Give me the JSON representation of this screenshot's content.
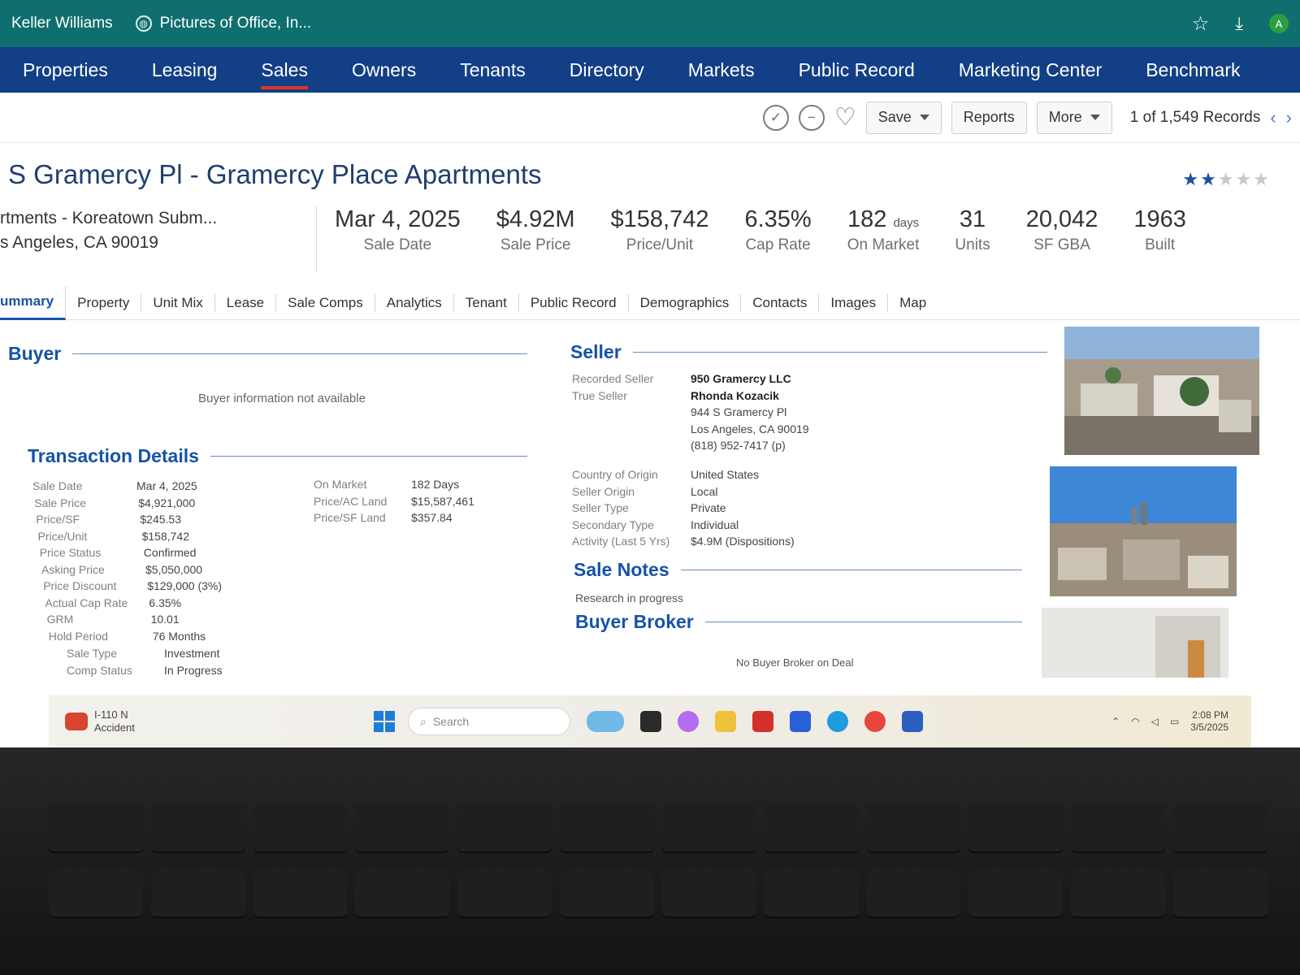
{
  "browser": {
    "bookmarks": [
      "Keller Williams",
      "Pictures of Office, In..."
    ],
    "avatar_initial": "A"
  },
  "nav": {
    "items": [
      "Properties",
      "Leasing",
      "Sales",
      "Owners",
      "Tenants",
      "Directory",
      "Markets",
      "Public Record",
      "Marketing Center",
      "Benchmark"
    ],
    "active": "Sales"
  },
  "toolbar": {
    "save_label": "Save",
    "reports_label": "Reports",
    "more_label": "More",
    "records_text": "1 of 1,549 Records"
  },
  "property": {
    "title": "S Gramercy Pl - Gramercy Place Apartments",
    "rating_stars": 2,
    "rating_max": 5,
    "address_line1": "rtments - Koreatown Subm...",
    "address_line2": "s Angeles, CA 90019"
  },
  "facts": [
    {
      "value": "Mar 4, 2025",
      "unit": "",
      "label": "Sale Date"
    },
    {
      "value": "$4.92M",
      "unit": "",
      "label": "Sale Price"
    },
    {
      "value": "$158,742",
      "unit": "",
      "label": "Price/Unit"
    },
    {
      "value": "6.35%",
      "unit": "",
      "label": "Cap Rate"
    },
    {
      "value": "182",
      "unit": "days",
      "label": "On Market"
    },
    {
      "value": "31",
      "unit": "",
      "label": "Units"
    },
    {
      "value": "20,042",
      "unit": "",
      "label": "SF GBA"
    },
    {
      "value": "1963",
      "unit": "",
      "label": "Built"
    }
  ],
  "tabs": [
    "ummary",
    "Property",
    "Unit Mix",
    "Lease",
    "Sale Comps",
    "Analytics",
    "Tenant",
    "Public Record",
    "Demographics",
    "Contacts",
    "Images",
    "Map"
  ],
  "buyer": {
    "heading": "Buyer",
    "message": "Buyer information not available"
  },
  "transaction": {
    "heading": "Transaction Details",
    "left": [
      {
        "k": "Sale Date",
        "v": "Mar 4, 2025"
      },
      {
        "k": "Sale Price",
        "v": "$4,921,000"
      },
      {
        "k": "Price/SF",
        "v": "$245.53"
      },
      {
        "k": "Price/Unit",
        "v": "$158,742"
      },
      {
        "k": "Price Status",
        "v": "Confirmed"
      },
      {
        "k": "Asking Price",
        "v": "$5,050,000"
      },
      {
        "k": "Price Discount",
        "v": "$129,000 (3%)"
      },
      {
        "k": "Actual Cap Rate",
        "v": "6.35%"
      },
      {
        "k": "GRM",
        "v": "10.01"
      },
      {
        "k": "Hold Period",
        "v": "76 Months"
      }
    ],
    "right": [
      {
        "k": "On Market",
        "v": "182 Days"
      },
      {
        "k": "Price/AC Land",
        "v": "$15,587,461"
      },
      {
        "k": "Price/SF Land",
        "v": "$357.84"
      }
    ],
    "bottom": [
      {
        "k": "Sale Type",
        "v": "Investment"
      },
      {
        "k": "Comp Status",
        "v": "In Progress"
      }
    ]
  },
  "seller": {
    "heading": "Seller",
    "recorded_seller_label": "Recorded Seller",
    "recorded_seller": "950 Gramercy LLC",
    "true_seller_label": "True Seller",
    "true_seller": "Rhonda Kozacik",
    "street": "944 S Gramercy Pl",
    "city": "Los Angeles, CA 90019",
    "phone": "(818) 952-7417 (p)",
    "details": [
      {
        "k": "Country of Origin",
        "v": "United States"
      },
      {
        "k": "Seller Origin",
        "v": "Local"
      },
      {
        "k": "Seller Type",
        "v": "Private"
      },
      {
        "k": "Secondary Type",
        "v": "Individual"
      },
      {
        "k": "Activity (Last 5 Yrs)",
        "v": "$4.9M (Dispositions)"
      }
    ]
  },
  "sale_notes": {
    "heading": "Sale Notes",
    "text": "Research in progress"
  },
  "buyer_broker": {
    "heading": "Buyer Broker",
    "text": "No Buyer Broker on Deal"
  },
  "taskbar": {
    "weather_line1": "I-110 N",
    "weather_line2": "Accident",
    "search_placeholder": "Search",
    "time": "2:08 PM",
    "date": "3/5/2025"
  }
}
